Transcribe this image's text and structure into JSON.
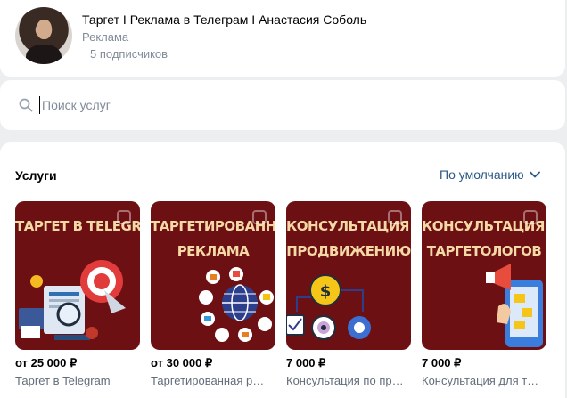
{
  "header": {
    "title": "Таргет I Реклама в Телеграм I Анастасия Соболь",
    "category": "Реклама",
    "subscribers": "5 подписчиков"
  },
  "search": {
    "placeholder": "Поиск услуг",
    "value": ""
  },
  "services": {
    "title": "Услуги",
    "sort_label": "По умолчанию",
    "items": [
      {
        "banner_lines": [
          "ТАРГЕТ В TELEGRAM"
        ],
        "price": "от 25 000 ₽",
        "name": "Таргет в Telegram"
      },
      {
        "banner_lines": [
          "ТАРГЕТИРОВАННАЯ",
          "РЕКЛАМА"
        ],
        "price": "от 30 000 ₽",
        "name": "Таргетированная реклама"
      },
      {
        "banner_lines": [
          "КОНСУЛЬТАЦИЯ ПО",
          "ПРОДВИЖЕНИЮ"
        ],
        "price": "7 000 ₽",
        "name": "Консультация по продвижению"
      },
      {
        "banner_lines": [
          "КОНСУЛЬТАЦИЯ ДЛЯ",
          "ТАРГЕТОЛОГОВ"
        ],
        "price": "7 000 ₽",
        "name": "Консультация для таргетологов"
      }
    ]
  },
  "colors": {
    "banner_bg": "#6d1013",
    "banner_text": "#f4d9a6",
    "link": "#2a5885",
    "muted": "#818c99"
  }
}
